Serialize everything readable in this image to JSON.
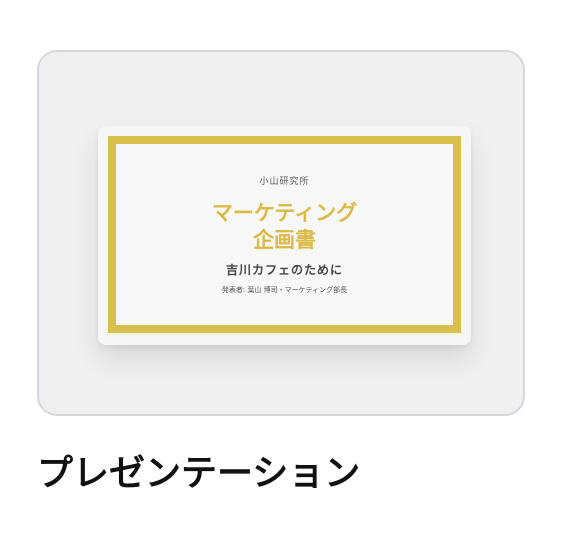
{
  "card": {
    "label": "プレゼンテーション"
  },
  "slide": {
    "organization": "小山研究所",
    "title_line1": "マーケティング",
    "title_line2": "企画書",
    "subtitle": "吉川カフェのために",
    "presenter": "発表者: 葉山 博司・マーケティング部長"
  },
  "colors": {
    "accent_gold": "#d9bf4c",
    "card_background": "#eff0f2",
    "card_border": "#d6d7da"
  }
}
